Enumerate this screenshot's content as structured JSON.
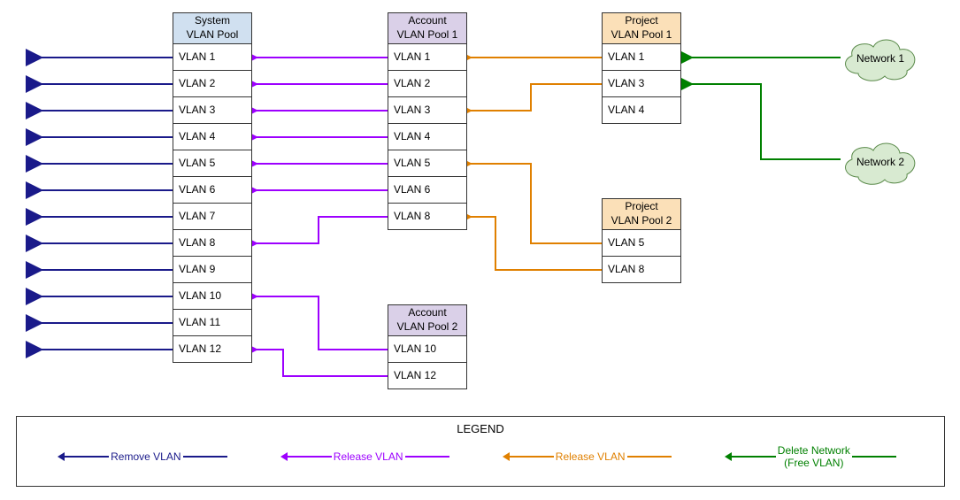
{
  "system_pool": {
    "title_l1": "System",
    "title_l2": "VLAN Pool",
    "items": [
      "VLAN 1",
      "VLAN 2",
      "VLAN 3",
      "VLAN 4",
      "VLAN 5",
      "VLAN 6",
      "VLAN 7",
      "VLAN 8",
      "VLAN 9",
      "VLAN 10",
      "VLAN 11",
      "VLAN 12"
    ]
  },
  "account_pool_1": {
    "title_l1": "Account",
    "title_l2": "VLAN Pool 1",
    "items": [
      "VLAN 1",
      "VLAN 2",
      "VLAN 3",
      "VLAN 4",
      "VLAN 5",
      "VLAN 6",
      "VLAN 8"
    ]
  },
  "account_pool_2": {
    "title_l1": "Account",
    "title_l2": "VLAN Pool 2",
    "items": [
      "VLAN 10",
      "VLAN 12"
    ]
  },
  "project_pool_1": {
    "title_l1": "Project",
    "title_l2": "VLAN Pool 1",
    "items": [
      "VLAN 1",
      "VLAN 3",
      "VLAN 4"
    ]
  },
  "project_pool_2": {
    "title_l1": "Project",
    "title_l2": "VLAN Pool 2",
    "items": [
      "VLAN 5",
      "VLAN 8"
    ]
  },
  "network_1": "Network 1",
  "network_2": "Network 2",
  "legend": {
    "title": "LEGEND",
    "remove": "Remove VLAN",
    "release1": "Release VLAN",
    "release2": "Release VLAN",
    "delete_l1": "Delete Network",
    "delete_l2": "(Free VLAN)"
  }
}
